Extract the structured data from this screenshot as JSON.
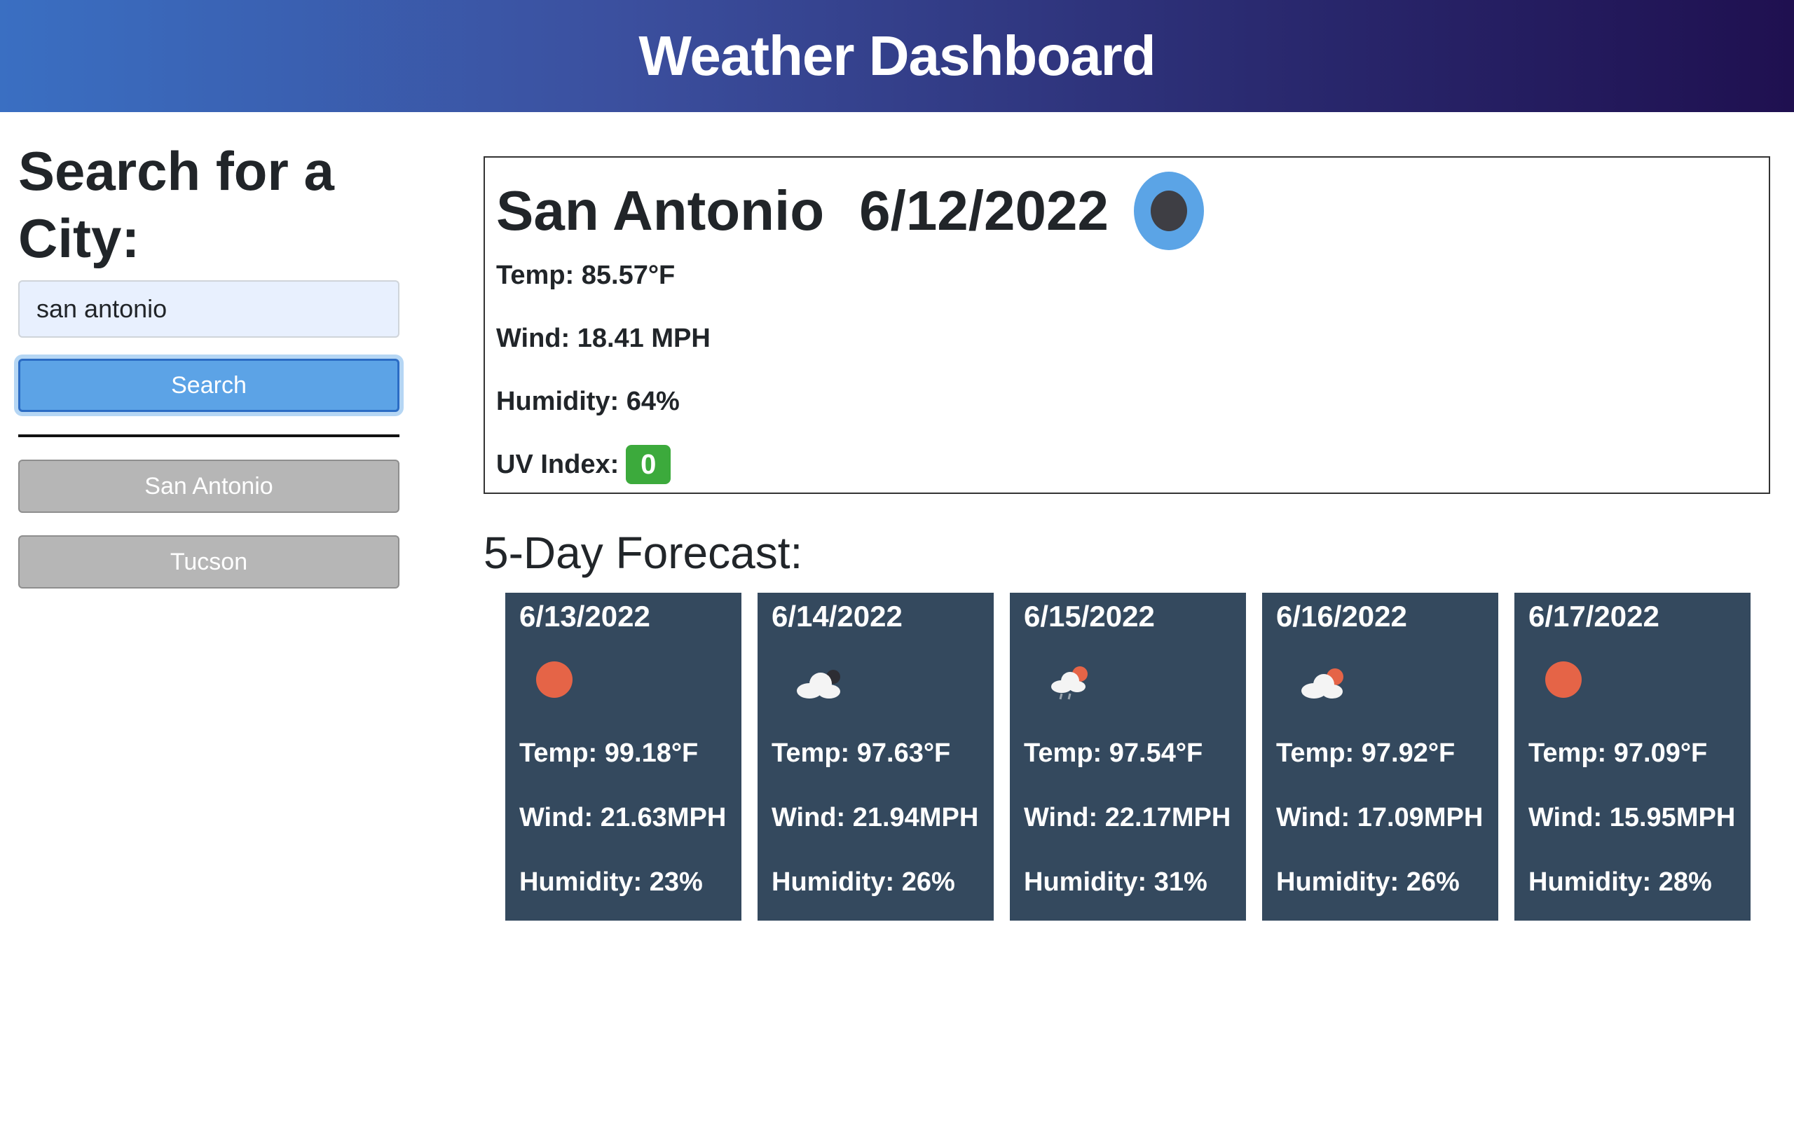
{
  "header": {
    "title": "Weather Dashboard"
  },
  "sidebar": {
    "heading": "Search for a City:",
    "search_value": "san antonio",
    "search_button": "Search",
    "history": [
      "San Antonio",
      "Tucson"
    ]
  },
  "current": {
    "city": "San Antonio",
    "date": "6/12/2022",
    "icon": "moon-icon",
    "temp": "Temp: 85.57°F",
    "wind": "Wind: 18.41 MPH",
    "humidity": "Humidity: 64%",
    "uv_label": "UV Index:",
    "uv_value": "0",
    "uv_color": "#3caa3c"
  },
  "forecast": {
    "title": "5-Day Forecast:",
    "days": [
      {
        "date": "6/13/2022",
        "icon": "sun-icon",
        "temp": "Temp: 99.18°F",
        "wind": "Wind: 21.63MPH",
        "humidity": "Humidity: 23%"
      },
      {
        "date": "6/14/2022",
        "icon": "cloud-moon-icon",
        "temp": "Temp: 97.63°F",
        "wind": "Wind: 21.94MPH",
        "humidity": "Humidity: 26%"
      },
      {
        "date": "6/15/2022",
        "icon": "cloud-sun-rain-icon",
        "temp": "Temp: 97.54°F",
        "wind": "Wind: 22.17MPH",
        "humidity": "Humidity: 31%"
      },
      {
        "date": "6/16/2022",
        "icon": "cloud-sun-icon",
        "temp": "Temp: 97.92°F",
        "wind": "Wind: 17.09MPH",
        "humidity": "Humidity: 26%"
      },
      {
        "date": "6/17/2022",
        "icon": "sun-icon",
        "temp": "Temp: 97.09°F",
        "wind": "Wind: 15.95MPH",
        "humidity": "Humidity: 28%"
      }
    ]
  },
  "colors": {
    "card_bg": "#34495e",
    "search_button": "#5ca3e6",
    "history_button": "#b6b6b6",
    "sun": "#e56447"
  }
}
